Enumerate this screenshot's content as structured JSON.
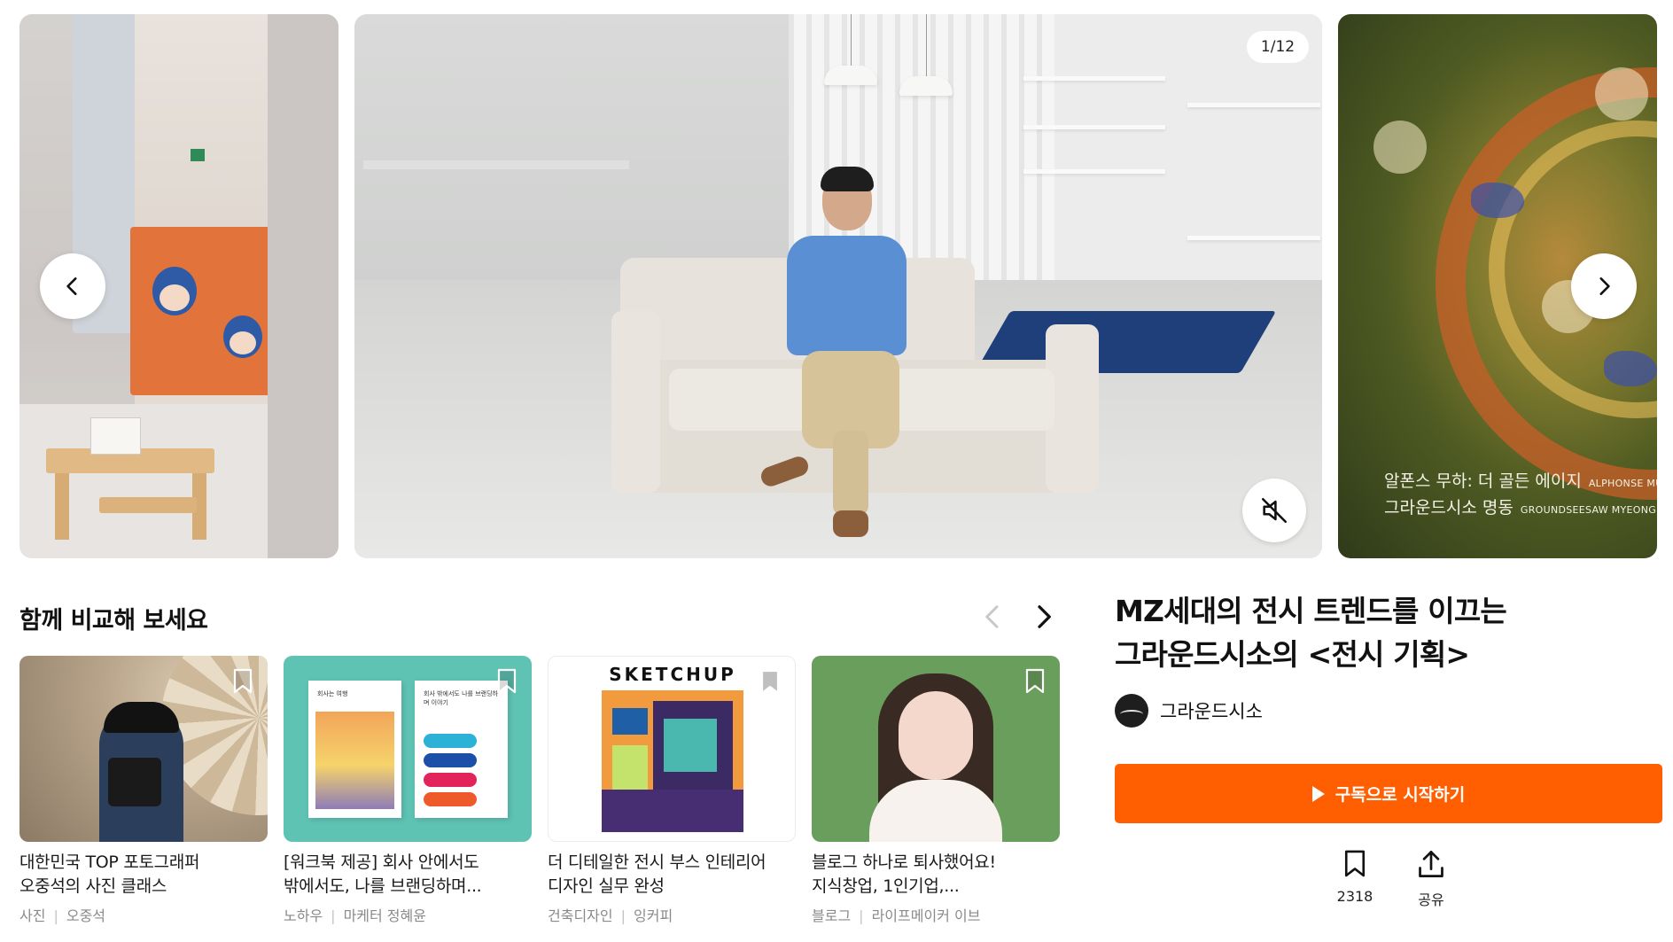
{
  "carousel": {
    "counter": "1/12",
    "prev_icon": "chevron-left-icon",
    "next_icon": "chevron-right-icon",
    "mute_icon": "volume-muted-icon",
    "right_slide_caption": {
      "line1": "알폰스 무하: 더 골든 에이지",
      "line1_en": "ALPHONSE MUC",
      "line2": "그라운드시소 명동",
      "line2_en": "GROUNDSEESAW MYEONGD"
    }
  },
  "compare": {
    "title": "함께 비교해 보세요",
    "cards": [
      {
        "title_line1": "대한민국 TOP 포토그래퍼",
        "title_line2": "오중석의 사진 클래스",
        "category": "사진",
        "creator": "오중석"
      },
      {
        "title_line1": "[워크북 제공] 회사 안에서도",
        "title_line2": "밖에서도, 나를 브랜딩하며...",
        "category": "노하우",
        "creator": "마케터 정혜윤",
        "book1_title": "회사는 여행",
        "book2_title": "회사 밖에서도 나를 브랜딩하며 이야기"
      },
      {
        "title_line1": "더 디테일한 전시 부스 인테리어",
        "title_line2": "디자인 실무 완성",
        "category": "건축디자인",
        "creator": "잉커피",
        "logo_text": "SKETCHUP"
      },
      {
        "title_line1": "블로그 하나로 퇴사했어요!",
        "title_line2": "지식창업, 1인기업,...",
        "category": "블로그",
        "creator": "라이프메이커 이브"
      }
    ]
  },
  "course": {
    "title_line1": "MZ세대의 전시 트렌드를 이끄는",
    "title_line2": "그라운드시소의 <전시 기획>",
    "creator": "그라운드시소",
    "cta_label": "구독으로 시작하기",
    "bookmark_count": "2318",
    "share_label": "공유"
  },
  "colors": {
    "accent": "#ff5f00",
    "text": "#111111",
    "meta": "#8a8a8a"
  }
}
